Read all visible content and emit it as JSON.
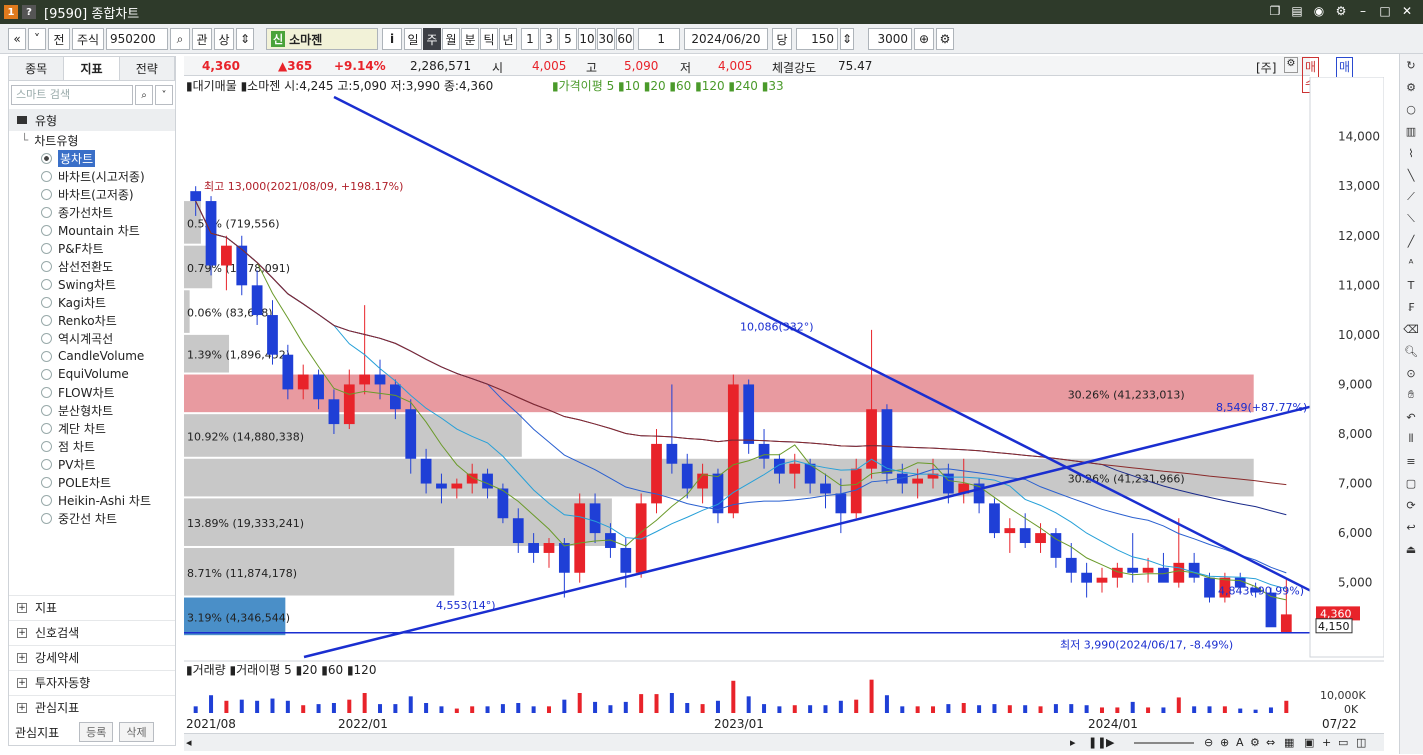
{
  "window": {
    "title": "[9590] 종합차트",
    "icons": [
      "restore-icon",
      "layout-icon",
      "camera-icon",
      "gear-icon",
      "minimize-icon",
      "maximize-icon",
      "close-icon"
    ]
  },
  "toolbar": {
    "type": "주식",
    "code": "950200",
    "stock_prefix": "신",
    "stock_name": "소마젠",
    "btn_jeon": "전",
    "btn_gwan": "관",
    "btn_sang": "상",
    "btn_i": "i",
    "periods": [
      "일",
      "주",
      "월",
      "분",
      "틱",
      "년"
    ],
    "selected_period": "주",
    "nums": [
      "1",
      "3",
      "5",
      "10",
      "30",
      "60"
    ],
    "interval": "1",
    "date": "2024/06/20",
    "dang": "당",
    "count": "150",
    "total": "3000"
  },
  "left": {
    "tabs": [
      "종목",
      "지표",
      "전략"
    ],
    "active_tab": "지표",
    "search_placeholder": "스마트 검색",
    "section": "유형",
    "tree_root": "차트유형",
    "items": [
      "봉차트",
      "바차트(시고저종)",
      "바차트(고저종)",
      "종가선차트",
      "Mountain 차트",
      "P&F차트",
      "삼선전환도",
      "Swing차트",
      "Kagi차트",
      "Renko차트",
      "역시계곡선",
      "CandleVolume",
      "EquiVolume",
      "FLOW차트",
      "분산형차트",
      "계단 차트",
      "점 차트",
      "PV차트",
      "POLE차트",
      "Heikin-Ashi 차트",
      "중간선 차트"
    ],
    "selected": "봉차트",
    "groups": [
      "지표",
      "신호검색",
      "강세약세",
      "투자자동향",
      "관심지표"
    ],
    "footer_label": "관심지표",
    "btn_register": "등록",
    "btn_delete": "삭제"
  },
  "quote": {
    "price": "4,360",
    "change": "▲365",
    "pct": "+9.14%",
    "volume": "2,286,571",
    "open_label": "시",
    "open": "4,005",
    "high_label": "고",
    "high": "5,090",
    "low_label": "저",
    "low": "4,005",
    "strength_label": "체결강도",
    "strength": "75.47",
    "ju": "[주]",
    "buy": "매수",
    "sell": "매도"
  },
  "legend": {
    "main": "▮대기매물 ▮소마젠 시:4,245 고:5,090 저:3,990 종:4,360",
    "ma": "▮가격이평 5 ▮10 ▮20 ▮60 ▮120 ▮240 ▮33",
    "vol": "▮거래량 ▮거래이평 5 ▮20 ▮60 ▮120"
  },
  "colors": {
    "up": "#e8232a",
    "down": "#1f3fd6",
    "profile": "#c8c8c8",
    "profile_hot": "#e89aa0",
    "profile_blue": "#4a8fc8"
  },
  "chart_data": {
    "type": "candlestick",
    "y_ticks": [
      "14,000",
      "13,000",
      "12,000",
      "11,000",
      "10,000",
      "9,000",
      "8,000",
      "7,000",
      "6,000",
      "5,000"
    ],
    "ylim": [
      3500,
      14800
    ],
    "x_ticks": [
      "2021/08",
      "2022/01",
      "2023/01",
      "2024/01",
      "07/22"
    ],
    "vol_ticks": [
      "10,000K",
      "0K"
    ],
    "profile": [
      {
        "label": "3.19% (4,346,544)",
        "lo": 3900,
        "hi": 4700,
        "w": 0.09,
        "hot": "blue"
      },
      {
        "label": "8.71% (11,874,178)",
        "lo": 4700,
        "hi": 5700,
        "w": 0.24
      },
      {
        "label": "13.89% (19,333,241)",
        "lo": 5700,
        "hi": 6700,
        "w": 0.38
      },
      {
        "label": "30.26% (41,231,966)",
        "lo": 6700,
        "hi": 7500,
        "w": 0.95
      },
      {
        "label": "10.92% (14,880,338)",
        "lo": 7500,
        "hi": 8400,
        "w": 0.3
      },
      {
        "label": "30.26% (41,233,013)",
        "lo": 8400,
        "hi": 9200,
        "w": 0.95,
        "hot": "red"
      },
      {
        "label": "1.39% (1,896,452)",
        "lo": 9200,
        "hi": 10000,
        "w": 0.04
      },
      {
        "label": "0.06% (83,678)",
        "lo": 10000,
        "hi": 10900,
        "w": 0.005
      },
      {
        "label": "0.79% (1,078,091)",
        "lo": 10900,
        "hi": 11800,
        "w": 0.025
      },
      {
        "label": "0.53% (719,556)",
        "lo": 11800,
        "hi": 12700,
        "w": 0.015
      }
    ],
    "candles": [
      [
        12900,
        13000,
        12400,
        12700
      ],
      [
        12700,
        12800,
        11200,
        11400
      ],
      [
        11400,
        12000,
        10900,
        11800
      ],
      [
        11800,
        12000,
        10800,
        11000
      ],
      [
        11000,
        11300,
        10200,
        10400
      ],
      [
        10400,
        10700,
        9400,
        9600
      ],
      [
        9600,
        9800,
        8700,
        8900
      ],
      [
        8900,
        9400,
        8700,
        9200
      ],
      [
        9200,
        9300,
        8500,
        8700
      ],
      [
        8700,
        8900,
        8000,
        8200
      ],
      [
        8200,
        9300,
        8100,
        9000
      ],
      [
        9000,
        10600,
        8800,
        9200
      ],
      [
        9200,
        9500,
        8700,
        9000
      ],
      [
        9000,
        9100,
        8300,
        8500
      ],
      [
        8500,
        8700,
        7200,
        7500
      ],
      [
        7500,
        7700,
        6800,
        7000
      ],
      [
        7000,
        7200,
        6600,
        6900
      ],
      [
        6900,
        7100,
        6700,
        7000
      ],
      [
        7000,
        7400,
        6800,
        7200
      ],
      [
        7200,
        7300,
        6700,
        6900
      ],
      [
        6900,
        7000,
        6200,
        6300
      ],
      [
        6300,
        6500,
        5600,
        5800
      ],
      [
        5800,
        6000,
        5400,
        5600
      ],
      [
        5600,
        5900,
        5300,
        5800
      ],
      [
        5800,
        5900,
        4700,
        5200
      ],
      [
        5200,
        6800,
        5000,
        6600
      ],
      [
        6600,
        6800,
        5800,
        6000
      ],
      [
        6000,
        6200,
        5500,
        5700
      ],
      [
        5700,
        5900,
        4900,
        5200
      ],
      [
        5200,
        6800,
        5100,
        6600
      ],
      [
        6600,
        8100,
        6400,
        7800
      ],
      [
        7800,
        9000,
        7200,
        7400
      ],
      [
        7400,
        7600,
        6700,
        6900
      ],
      [
        6900,
        7400,
        6600,
        7200
      ],
      [
        7200,
        7300,
        6200,
        6400
      ],
      [
        6400,
        9200,
        6300,
        9000
      ],
      [
        9000,
        9100,
        7600,
        7800
      ],
      [
        7800,
        8100,
        7300,
        7500
      ],
      [
        7500,
        7600,
        7000,
        7200
      ],
      [
        7200,
        7600,
        6900,
        7400
      ],
      [
        7400,
        7500,
        6800,
        7000
      ],
      [
        7000,
        7200,
        6500,
        6800
      ],
      [
        6800,
        7100,
        6000,
        6400
      ],
      [
        6400,
        7500,
        6300,
        7300
      ],
      [
        7300,
        10100,
        7100,
        8500
      ],
      [
        8500,
        8600,
        7000,
        7200
      ],
      [
        7200,
        7400,
        6800,
        7000
      ],
      [
        7000,
        7300,
        6700,
        7100
      ],
      [
        7100,
        7500,
        6900,
        7200
      ],
      [
        7200,
        7400,
        6600,
        6800
      ],
      [
        6800,
        7500,
        6600,
        7000
      ],
      [
        7000,
        7100,
        6400,
        6600
      ],
      [
        6600,
        6700,
        5900,
        6000
      ],
      [
        6000,
        6300,
        5600,
        6100
      ],
      [
        6100,
        6400,
        5700,
        5800
      ],
      [
        5800,
        6200,
        5600,
        6000
      ],
      [
        6000,
        6100,
        5300,
        5500
      ],
      [
        5500,
        5800,
        5000,
        5200
      ],
      [
        5200,
        5400,
        4700,
        5000
      ],
      [
        5000,
        5300,
        4800,
        5100
      ],
      [
        5100,
        5400,
        4900,
        5300
      ],
      [
        5300,
        6000,
        5000,
        5200
      ],
      [
        5200,
        5500,
        5000,
        5300
      ],
      [
        5300,
        5600,
        5100,
        5000
      ],
      [
        5000,
        6300,
        4900,
        5400
      ],
      [
        5400,
        5600,
        5000,
        5100
      ],
      [
        5100,
        5200,
        4600,
        4700
      ],
      [
        4700,
        5200,
        4600,
        5100
      ],
      [
        5100,
        5200,
        4800,
        4900
      ],
      [
        4900,
        5000,
        4700,
        4800
      ],
      [
        4800,
        4900,
        4400,
        4100
      ],
      [
        4005,
        5090,
        3990,
        4360
      ]
    ],
    "resistance_label": "10,086(332°)",
    "support_label": "4,553(14°)",
    "trend_right_label": "8,549(+87.77%)",
    "trend_right_label2": "4,843(-90.99%)",
    "max_label": "최고 13,000(2021/08/09, +198.17%)",
    "min_label": "최저 3,990(2024/06/17, -8.49%)",
    "last_price_tag": "4,360",
    "crosshair_tag": "4,150"
  },
  "scroll": {
    "controls": [
      "prev",
      "pause",
      "play",
      "zoom-out",
      "zoom-in",
      "reset",
      "gear"
    ]
  },
  "rightbar": [
    "refresh-icon",
    "gear-icon",
    "circle-icon",
    "bar-icon",
    "draw-icon",
    "line-icon",
    "ruler-icon",
    "measure-icon",
    "diag-icon",
    "auto-icon",
    "text-icon",
    "fib-icon",
    "erase-icon",
    "zoom-icon",
    "zoom2-icon",
    "hand-icon",
    "undo-icon",
    "vlines-icon",
    "hlines-icon",
    "box-icon",
    "sync-icon",
    "back-icon",
    "exit-icon"
  ]
}
